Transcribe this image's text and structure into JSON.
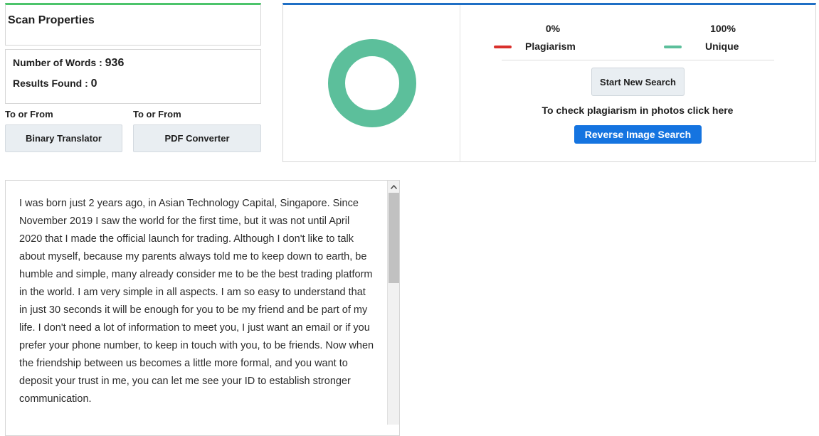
{
  "scan": {
    "title": "Scan Properties",
    "words_label": "Number of Words : ",
    "words_value": "936",
    "results_label": "Results Found : ",
    "results_value": "0"
  },
  "tools": [
    {
      "caption": "To or From",
      "button": "Binary Translator"
    },
    {
      "caption": "To or From",
      "button": "PDF Converter"
    }
  ],
  "result": {
    "plagiarism_pct": "0%",
    "plagiarism_label": "Plagiarism",
    "unique_pct": "100%",
    "unique_label": "Unique",
    "plagiarism_fraction": 0.0,
    "unique_fraction": 1.0,
    "start_button": "Start New Search",
    "photo_text": "To check plagiarism in photos click here",
    "reverse_button": "Reverse Image Search",
    "colors": {
      "plagiarism": "#d9302c",
      "unique": "#5cbf9b",
      "accent_top": "#1f6fc5",
      "scan_top": "#4cc46b",
      "reverse_button": "#1574e0"
    }
  },
  "content": {
    "text": "I was born just 2 years ago, in Asian Technology Capital, Singapore. Since November 2019 I saw the world for the first time, but it was not until April 2020 that I made the official launch for trading. Although I don't like to talk about myself, because my parents always told me to keep down to earth, be humble and simple, many already consider me to be the best trading platform in the world. I am very simple in all aspects. I am so easy to understand that in just 30 seconds it will be enough for you to be my friend and be part of my life. I don't need a lot of information to meet you, I just want an email or if you prefer your phone number, to keep in touch with you, to be friends. Now when the friendship between us becomes a little more formal, and you want to deposit your trust in me, you can let me see your ID to establish stronger communication."
  },
  "icons": {
    "scroll_up": "chevron-up-icon"
  }
}
